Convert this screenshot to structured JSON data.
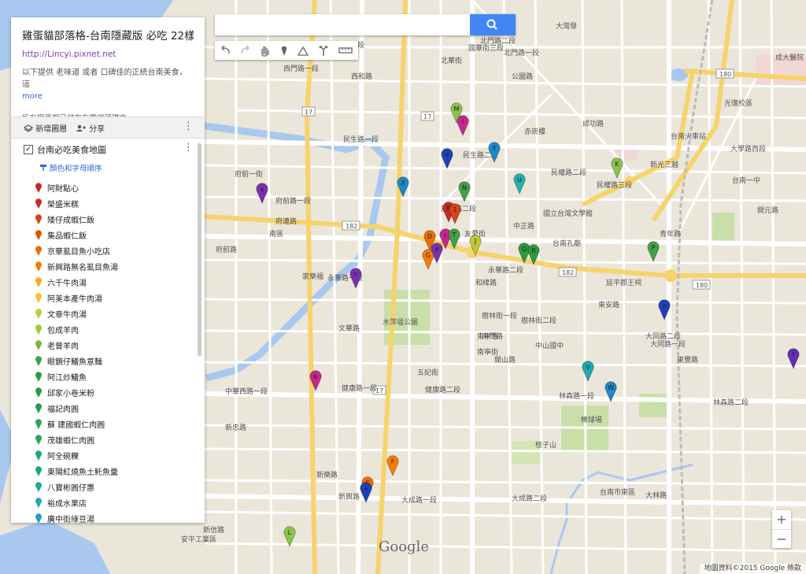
{
  "panel": {
    "title": "雞蛋貓部落格-台南隱藏版 必吃 22樣...",
    "link": "http://Lincyi.pixnet.net",
    "description": "以下提供 老味道 或者 口碑佳的正統台南美食，這",
    "more": "more",
    "saved": "所有變更都已儲存在雲端硬碟中",
    "add_layer": "新增圖層",
    "share": "分享",
    "layer_title": "台南必吃美食地圖",
    "layer_style": "顏色和字母順序",
    "items": [
      {
        "label": "阿財點心",
        "color": "#c62828"
      },
      {
        "label": "榮盛米糕",
        "color": "#c62828"
      },
      {
        "label": "矮仔成蝦仁飯",
        "color": "#d84315"
      },
      {
        "label": "集品蝦仁飯",
        "color": "#e65100"
      },
      {
        "label": "京華虱目魚小吃店",
        "color": "#ef6c00"
      },
      {
        "label": "新興路無名虱目魚湯",
        "color": "#f57c00"
      },
      {
        "label": "六千牛肉湯",
        "color": "#f9a825"
      },
      {
        "label": "阿美本產牛肉湯",
        "color": "#fbc02d"
      },
      {
        "label": "文章牛肉湯",
        "color": "#c0ca33"
      },
      {
        "label": "包成羊肉",
        "color": "#9ccc24"
      },
      {
        "label": "老曾羊肉",
        "color": "#7cb342"
      },
      {
        "label": "眼鏡仔鱔魚意麵",
        "color": "#43a047"
      },
      {
        "label": "阿江炒鱔魚",
        "color": "#2e9a3e"
      },
      {
        "label": "邱家小卷米粉",
        "color": "#2e9a3e"
      },
      {
        "label": "福記肉圓",
        "color": "#2e9a4e"
      },
      {
        "label": "蘇 建國蝦仁肉圓",
        "color": "#26a65a"
      },
      {
        "label": "茂雄蝦仁肉圓",
        "color": "#26a65a"
      },
      {
        "label": "阿全碗粿",
        "color": "#1fa86a"
      },
      {
        "label": "東陽紅燒魚土魠魚羹",
        "color": "#1fa880"
      },
      {
        "label": "八寶彬圓仔惠",
        "color": "#1eaa94"
      },
      {
        "label": "裕成水果店",
        "color": "#1eaab0"
      },
      {
        "label": "廣中街綠豆湯",
        "color": "#1ea0c0"
      }
    ]
  },
  "search": {
    "placeholder": ""
  },
  "toolbar": {
    "icons": [
      "undo-icon",
      "redo-icon",
      "hand-icon",
      "marker-icon",
      "draw-line-icon",
      "directions-icon",
      "ruler-icon"
    ]
  },
  "zoom": {
    "in": "+",
    "out": "−"
  },
  "attribution": "地圖資料©2015 Google   條款",
  "google_logo": "Google",
  "map_labels": [
    "大灣發",
    "成大醫院",
    "國華街三段",
    "西和路",
    "西門路三段",
    "西賢一街",
    "公園路",
    "成功路",
    "北門路一段",
    "北門路二段",
    "光復校區",
    "台南火車站",
    "大學路西段",
    "赤崁樓",
    "民權路二段",
    "民權路三段",
    "新光三越",
    "台南一中",
    "民生路一段",
    "民生路二段",
    "中正路",
    "國立台灣文學館",
    "台南孔廟",
    "青年路",
    "府前路一段",
    "府前路二段",
    "府前一街",
    "府前路",
    "家樂福",
    "永華路一段",
    "永華路二段",
    "延平郡王祠",
    "水萍塭公園",
    "樹林街一段",
    "樹林街二段",
    "南門路",
    "健康路一段",
    "健康路二段",
    "中山國中",
    "中華西路一段",
    "林森路一段",
    "林森路二段",
    "棒球場",
    "桂子山",
    "新興路",
    "大成路一段",
    "大成路二段",
    "安平工業區",
    "新信路",
    "府連路",
    "南區",
    "新忠路",
    "開山路",
    "大同路二段",
    "大林路",
    "台南市東區",
    "東寧路",
    "東安路",
    "東豐路",
    "大同路一段",
    "友愛街",
    "南寧街",
    "西門路一段",
    "新樂路",
    "開元路",
    "五妃街",
    "國華街一段",
    "和緯路",
    "文華路",
    "北華街"
  ],
  "map_pins": [
    {
      "letter": "M",
      "color": "#8bc34a"
    },
    {
      "letter": "I",
      "color": "#c6268c"
    },
    {
      "letter": "e",
      "color": "#1e40b8"
    },
    {
      "letter": "Y",
      "color": "#1e88c8"
    },
    {
      "letter": "X",
      "color": "#1e88c8"
    },
    {
      "letter": "U",
      "color": "#20b2aa"
    },
    {
      "letter": "N",
      "color": "#43a047"
    },
    {
      "letter": "K",
      "color": "#8bc34a"
    },
    {
      "letter": "a",
      "color": "#7b2fb0"
    },
    {
      "letter": "B",
      "color": "#c62828"
    },
    {
      "letter": "1",
      "color": "#d84315"
    },
    {
      "letter": "D",
      "color": "#ef6c00"
    },
    {
      "letter": "c",
      "color": "#c6268c"
    },
    {
      "letter": "T",
      "color": "#43a047"
    },
    {
      "letter": "J",
      "color": "#c0ca33"
    },
    {
      "letter": "Q",
      "color": "#2e9a3e"
    },
    {
      "letter": "R",
      "color": "#2e9a3e"
    },
    {
      "letter": "P",
      "color": "#43a047"
    },
    {
      "letter": "G",
      "color": "#f57c00"
    },
    {
      "letter": "e",
      "color": "#7b2fb0"
    },
    {
      "letter": "h",
      "color": "#7b2fb0"
    },
    {
      "letter": "n",
      "color": "#1e40b8"
    },
    {
      "letter": "V",
      "color": "#1eaab0"
    },
    {
      "letter": "W",
      "color": "#1e88c8"
    },
    {
      "letter": "k",
      "color": "#c6268c"
    },
    {
      "letter": "F",
      "color": "#f57c00"
    },
    {
      "letter": "C",
      "color": "#ef6c00"
    },
    {
      "letter": "e",
      "color": "#1e40b8"
    },
    {
      "letter": "L",
      "color": "#8bc34a"
    },
    {
      "letter": "f",
      "color": "#5e2fb0"
    }
  ]
}
